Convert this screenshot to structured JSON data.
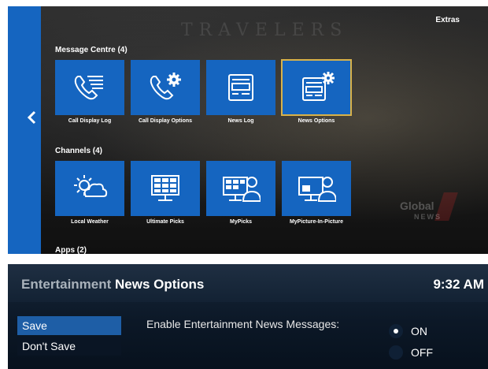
{
  "top": {
    "extras_label": "Extras",
    "watermark_text": "TRAVELERS",
    "back_icon": "chevron-left-icon",
    "sections": {
      "message_centre": "Message Centre (4)",
      "channels": "Channels (4)",
      "apps": "Apps (2)"
    },
    "message_centre_tiles": [
      {
        "label": "Call Display Log",
        "icon": "phone-list-icon"
      },
      {
        "label": "Call Display Options",
        "icon": "phone-gear-icon"
      },
      {
        "label": "News Log",
        "icon": "news-icon"
      },
      {
        "label": "News Options",
        "icon": "news-gear-icon",
        "selected": true
      }
    ],
    "channel_tiles": [
      {
        "label": "Local Weather",
        "icon": "weather-icon"
      },
      {
        "label": "Ultimate Picks",
        "icon": "grid-tv-icon"
      },
      {
        "label": "MyPicks",
        "icon": "grid-tv-person-icon"
      },
      {
        "label": "MyPicture-In-Picture",
        "icon": "pip-person-icon"
      }
    ],
    "logo": {
      "main": "Global",
      "sub": "NEWS"
    },
    "colors": {
      "tile": "#1565c0",
      "rail": "#1565c0",
      "selected_border": "#d8b24a"
    }
  },
  "bottom": {
    "title_part1": "Entertainment",
    "title_part2": "News Options",
    "time": "9:32 AM",
    "menu": [
      {
        "label": "Save",
        "selected": true
      },
      {
        "label": "Don't Save",
        "selected": false
      }
    ],
    "option_label": "Enable Entertainment News Messages:",
    "radio": [
      {
        "label": "ON",
        "checked": true
      },
      {
        "label": "OFF",
        "checked": false
      }
    ],
    "colors": {
      "header": "#1f2f42",
      "selection": "#1e5ea6"
    }
  }
}
